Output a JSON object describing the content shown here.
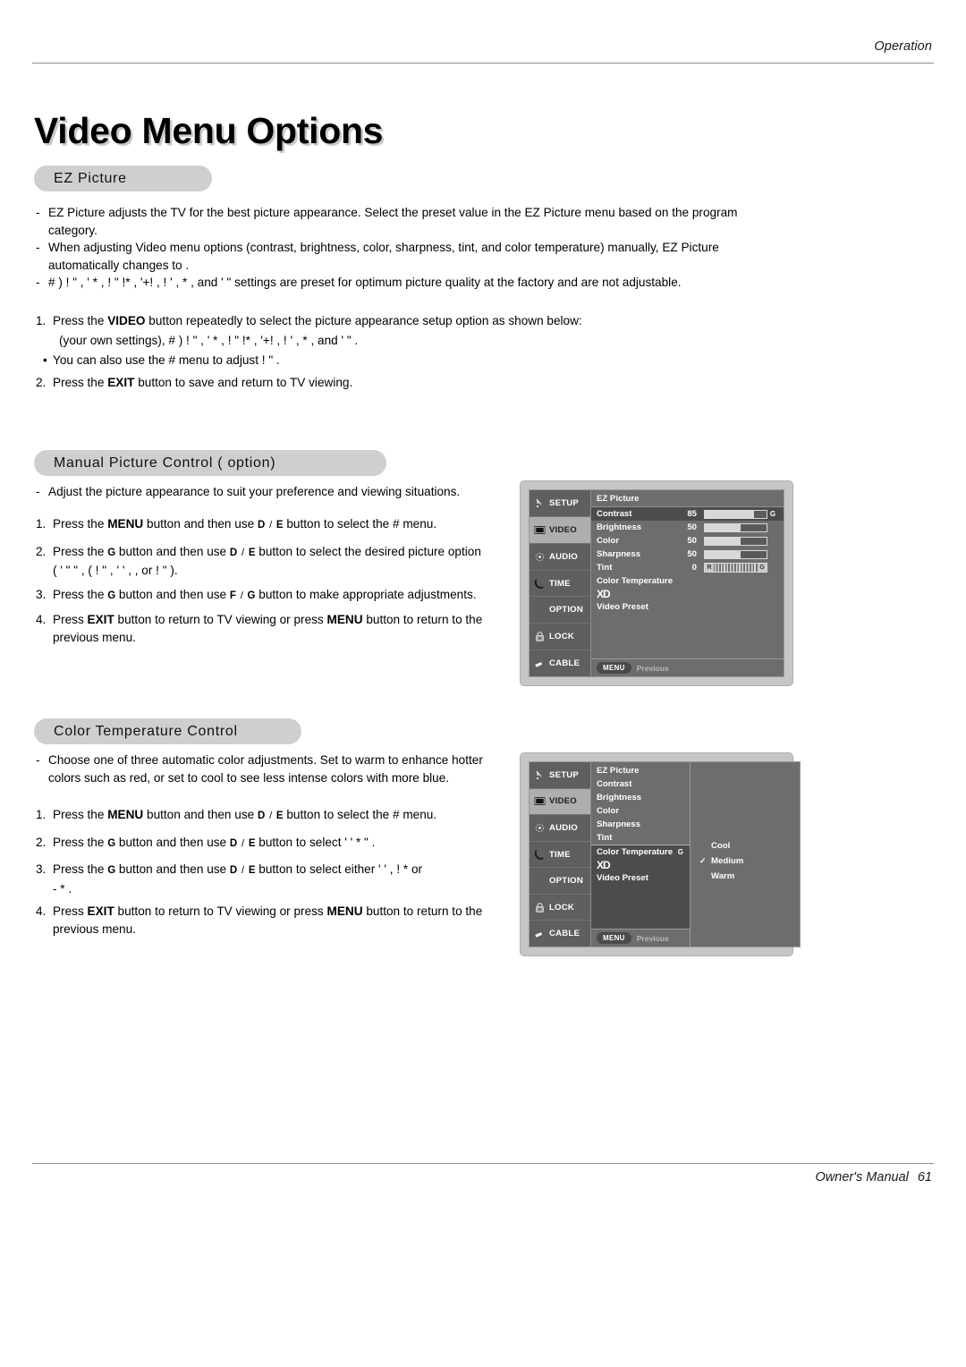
{
  "header": {
    "running_head": "Operation"
  },
  "footer": {
    "label": "Owner's Manual",
    "page_number": "61"
  },
  "title": "Video Menu Options",
  "sections": {
    "ez_picture": {
      "heading": "EZ Picture",
      "bullets": [
        "EZ Picture adjusts the TV for the best picture appearance. Select the preset value in the EZ Picture menu based on the program category.",
        "When adjusting Video menu options (contrast, brightness, color, sharpness, tint, and color temperature) manually, EZ Picture automatically changes to    .",
        "# ) ! \"        , ' *          , ! \" !*           , '+!     , ! ' , *                , and  ' \"       settings are preset for optimum picture quality at the factory and are not adjustable."
      ],
      "steps": [
        {
          "num": "1.",
          "text_html": "Press the <b>VIDEO</b> button repeatedly to select the picture appearance setup option as shown below:"
        },
        {
          "num": "",
          "text_html": "(your own settings), # ) ! \"       , ' *        , ! \" !*         , '+!    , ! ' , *            , and  ' \"     ."
        },
        {
          "num": "•",
          "text_html": "You can also use the  #      menu to adjust    ! \"        ."
        },
        {
          "num": "2.",
          "text_html": "Press the <b>EXIT</b> button to save and return to TV viewing."
        }
      ]
    },
    "manual_picture_control": {
      "heading": "Manual Picture Control (     option)",
      "bullets": [
        "Adjust the picture appearance to suit your preference and viewing situations."
      ],
      "steps": [
        {
          "num": "1.",
          "text_html": "Press the <b>MENU</b> button and then use <span class=\"key\">D</span> <span class=\"sep\">/</span> <span class=\"key\">E</span>  button to select the  #        menu."
        },
        {
          "num": "2.",
          "text_html": "Press the <span class=\"key\">G</span>  button and then use <span class=\"key\">D</span> <span class=\"sep\">/</span> <span class=\"key\">E</span> button to select the desired picture option"
        },
        {
          "num": "",
          "text_html": "( ' \" \"        , ( ! \"              , ' '       ,                        , or  ! \"    )."
        },
        {
          "num": "3.",
          "text_html": "Press the <span class=\"key\">G</span>  button and then use <span class=\"key\">F</span> <span class=\"sep\">/</span> <span class=\"key\">G</span> button to make appropriate adjustments."
        },
        {
          "num": "4.",
          "text_html": "Press <b>EXIT</b> button to return to TV viewing or press <b>MENU</b> button to return to the previous menu."
        }
      ]
    },
    "color_temperature_control": {
      "heading": "Color Temperature Control",
      "bullets": [
        "Choose one of three automatic color adjustments. Set to warm to enhance hotter colors such as red, or set to cool to see less intense colors with more blue."
      ],
      "steps": [
        {
          "num": "1.",
          "text_html": "Press the <b>MENU</b> button and then use <span class=\"key\">D</span> <span class=\"sep\">/</span> <span class=\"key\">E</span>  button to select the  #        menu."
        },
        {
          "num": "2.",
          "text_html": "Press the <span class=\"key\">G</span>   button and then use <span class=\"key\">D</span> <span class=\"sep\">/</span> <span class=\"key\">E</span> button to select  ' '   *   \"                    ."
        },
        {
          "num": "3.",
          "text_html": "Press the <span class=\"key\">G</span>   button and then use <span class=\"key\">D</span> <span class=\"sep\">/</span> <span class=\"key\">E</span> button to select either  ' '        ,   ! *          or"
        },
        {
          "num": "",
          "text_html": "- *        ."
        },
        {
          "num": "4.",
          "text_html": "Press <b>EXIT</b> button to return to TV viewing or press <b>MENU</b> button to return to the previous menu."
        }
      ]
    }
  },
  "osd_menu_1": {
    "sidebar": [
      {
        "label": "SETUP",
        "icon": "antenna-icon",
        "active": false
      },
      {
        "label": "VIDEO",
        "icon": "screen-icon",
        "active": true
      },
      {
        "label": "AUDIO",
        "icon": "speaker-icon",
        "active": false
      },
      {
        "label": "TIME",
        "icon": "clock-icon",
        "active": false
      },
      {
        "label": "OPTION",
        "icon": "option-icon",
        "active": false
      },
      {
        "label": "LOCK",
        "icon": "padlock-icon",
        "active": false
      },
      {
        "label": "CABLE",
        "icon": "cable-plug-icon",
        "active": false
      }
    ],
    "menu_header": "EZ Picture",
    "rows": [
      {
        "label": "Contrast",
        "value": "85",
        "fill_pct": 80,
        "selected": true,
        "gmark": "G"
      },
      {
        "label": "Brightness",
        "value": "50",
        "fill_pct": 58,
        "selected": false,
        "gmark": ""
      },
      {
        "label": "Color",
        "value": "50",
        "fill_pct": 58,
        "selected": false,
        "gmark": ""
      },
      {
        "label": "Sharpness",
        "value": "50",
        "fill_pct": 58,
        "selected": false,
        "gmark": ""
      }
    ],
    "tint_row": {
      "label": "Tint",
      "value": "0",
      "left_cap": "R",
      "right_cap": "G"
    },
    "plain_rows": [
      "Color Temperature"
    ],
    "xd_logo": "XD",
    "video_preset": "Video Preset",
    "footer": {
      "chip": "MENU",
      "label": "Previous"
    }
  },
  "osd_menu_2": {
    "sidebar": [
      {
        "label": "SETUP",
        "icon": "antenna-icon",
        "active": false
      },
      {
        "label": "VIDEO",
        "icon": "screen-icon",
        "active": true
      },
      {
        "label": "AUDIO",
        "icon": "speaker-icon",
        "active": false
      },
      {
        "label": "TIME",
        "icon": "clock-icon",
        "active": false
      },
      {
        "label": "OPTION",
        "icon": "option-icon",
        "active": false
      },
      {
        "label": "LOCK",
        "icon": "padlock-icon",
        "active": false
      },
      {
        "label": "CABLE",
        "icon": "cable-plug-icon",
        "active": false
      }
    ],
    "menu_items": [
      "EZ Picture",
      "Contrast",
      "Brightness",
      "Color",
      "Sharpness",
      "Tint"
    ],
    "selected_item": "Color Temperature",
    "selected_item_arrow": "G",
    "xd_logo": "XD",
    "video_preset": "Video Preset",
    "submenu_options": [
      {
        "label": "Cool",
        "checked": false
      },
      {
        "label": "Medium",
        "checked": true
      },
      {
        "label": "Warm",
        "checked": false
      }
    ],
    "check_glyph": "✓",
    "footer": {
      "chip": "MENU",
      "label": "Previous"
    }
  },
  "colors": {
    "pill_bg": "#cfcfcf",
    "osd_frame": "#c6c6c6",
    "osd_body": "#6d6d6d",
    "osd_selected": "#4c4c4c",
    "osd_sidebar": "#5f5f5f",
    "osd_active_tab": "#aeaeae",
    "bar_fill": "#d8d8d8",
    "rule": "#8d8d8d"
  }
}
